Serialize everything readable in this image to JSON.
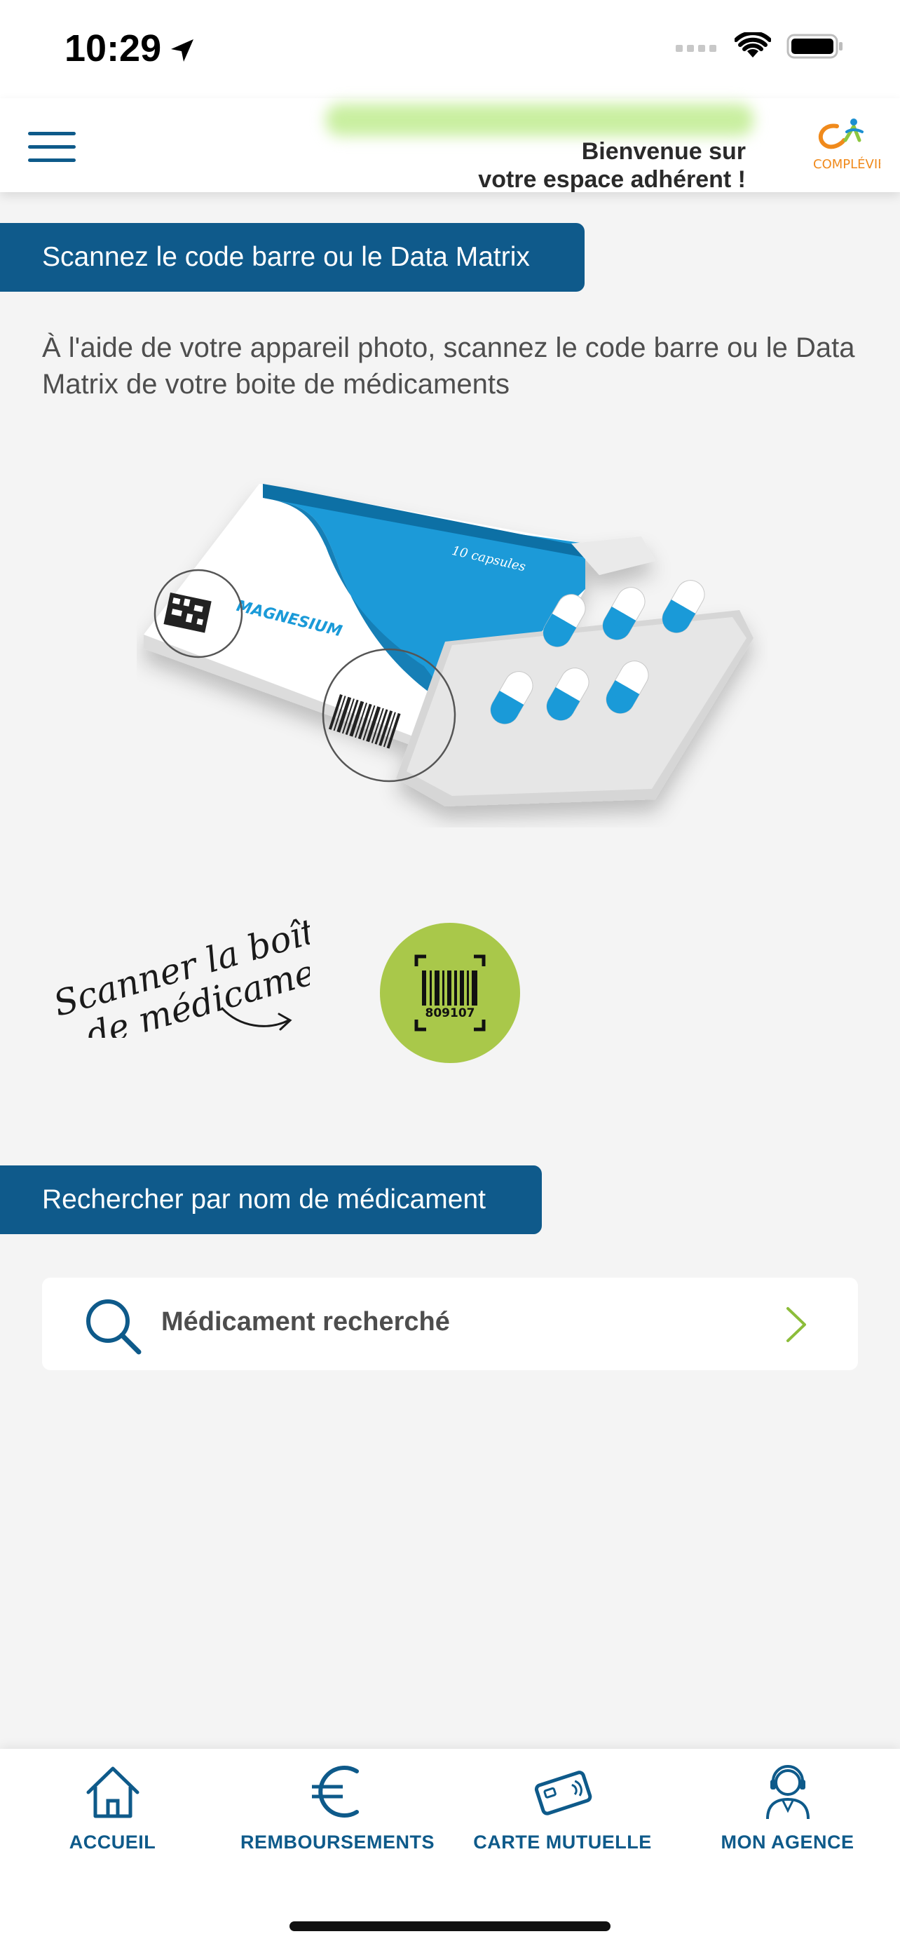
{
  "status_bar": {
    "time": "10:29"
  },
  "header": {
    "welcome_line1": "Bienvenue sur",
    "welcome_line2": "votre espace adhérent !",
    "logo_text": "COMPLÉVIE"
  },
  "scan_section": {
    "title": "Scannez le code barre ou le Data Matrix",
    "instructions": "À l'aide de votre appareil photo, scannez le code barre ou le Data Matrix de votre boite de médicaments",
    "box_label": "MAGNESIUM",
    "box_count": "10 capsules",
    "caption_line1": "Scanner la boîte",
    "caption_line2": "de médicaments",
    "scan_code": "809107"
  },
  "search_section": {
    "title": "Rechercher par nom de médicament",
    "search_label": "Médicament recherché"
  },
  "tabs": [
    {
      "label": "ACCUEIL",
      "icon": "home-icon"
    },
    {
      "label": "REMBOURSEMENTS",
      "icon": "euro-icon"
    },
    {
      "label": "CARTE MUTUELLE",
      "icon": "card-icon"
    },
    {
      "label": "MON AGENCE",
      "icon": "agent-icon"
    }
  ],
  "colors": {
    "primary": "#0f5a8b",
    "accent_green": "#a9c84a",
    "box_blue": "#1a9ad8"
  }
}
